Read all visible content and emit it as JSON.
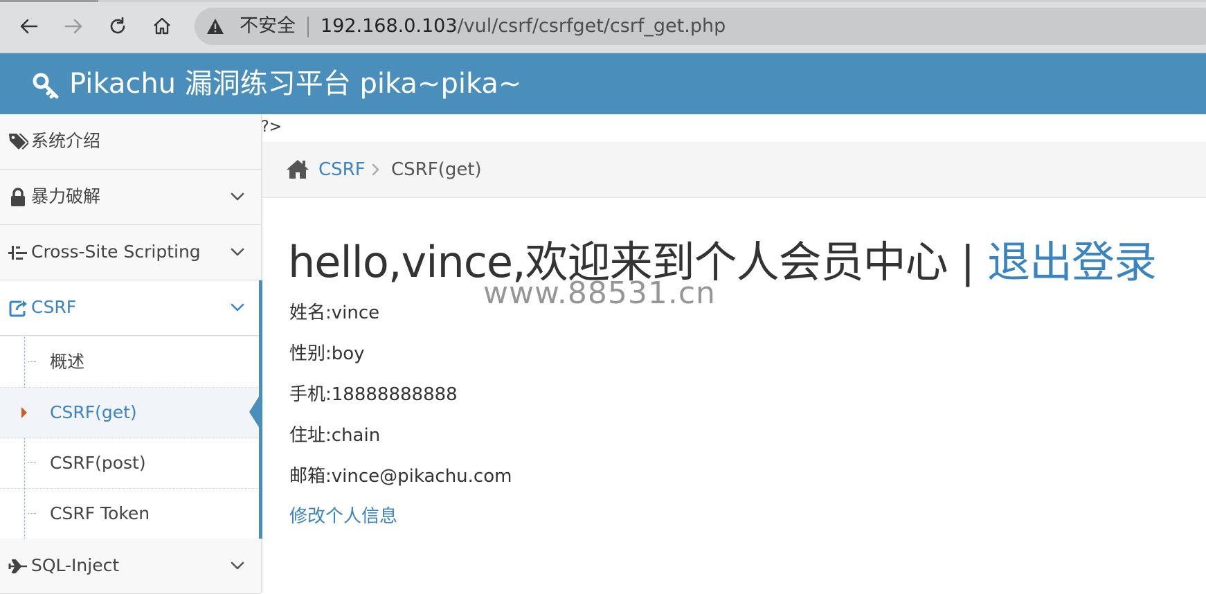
{
  "browser": {
    "security_label": "不安全",
    "url_host": "192.168.0.103",
    "url_path": "/vul/csrf/csrfget/csrf_get.php"
  },
  "app": {
    "title": "Pikachu 漏洞练习平台 pika~pika~",
    "brand_color": "#4a8fbb"
  },
  "sidebar": {
    "items": [
      {
        "label": "系统介绍",
        "icon": "tags-icon"
      },
      {
        "label": "暴力破解",
        "icon": "lock-icon"
      },
      {
        "label": "Cross-Site Scripting",
        "icon": "list-tree-icon"
      },
      {
        "label": "CSRF",
        "icon": "share-square-icon"
      },
      {
        "label": "SQL-Inject",
        "icon": "plane-icon"
      }
    ],
    "csrf_sub": [
      {
        "label": "概述"
      },
      {
        "label": "CSRF(get)"
      },
      {
        "label": "CSRF(post)"
      },
      {
        "label": "CSRF Token"
      }
    ]
  },
  "main": {
    "stray_text": "?>",
    "breadcrumb": {
      "parent": "CSRF",
      "current": "CSRF(get)"
    },
    "welcome_text": "hello,vince,欢迎来到个人会员中心 | ",
    "logout_label": "退出登录",
    "watermark": "www.88531.cn",
    "profile": [
      "姓名:vince",
      "性别:boy",
      "手机:18888888888",
      "住址:chain",
      "邮箱:vince@pikachu.com"
    ],
    "edit_link": "修改个人信息"
  }
}
